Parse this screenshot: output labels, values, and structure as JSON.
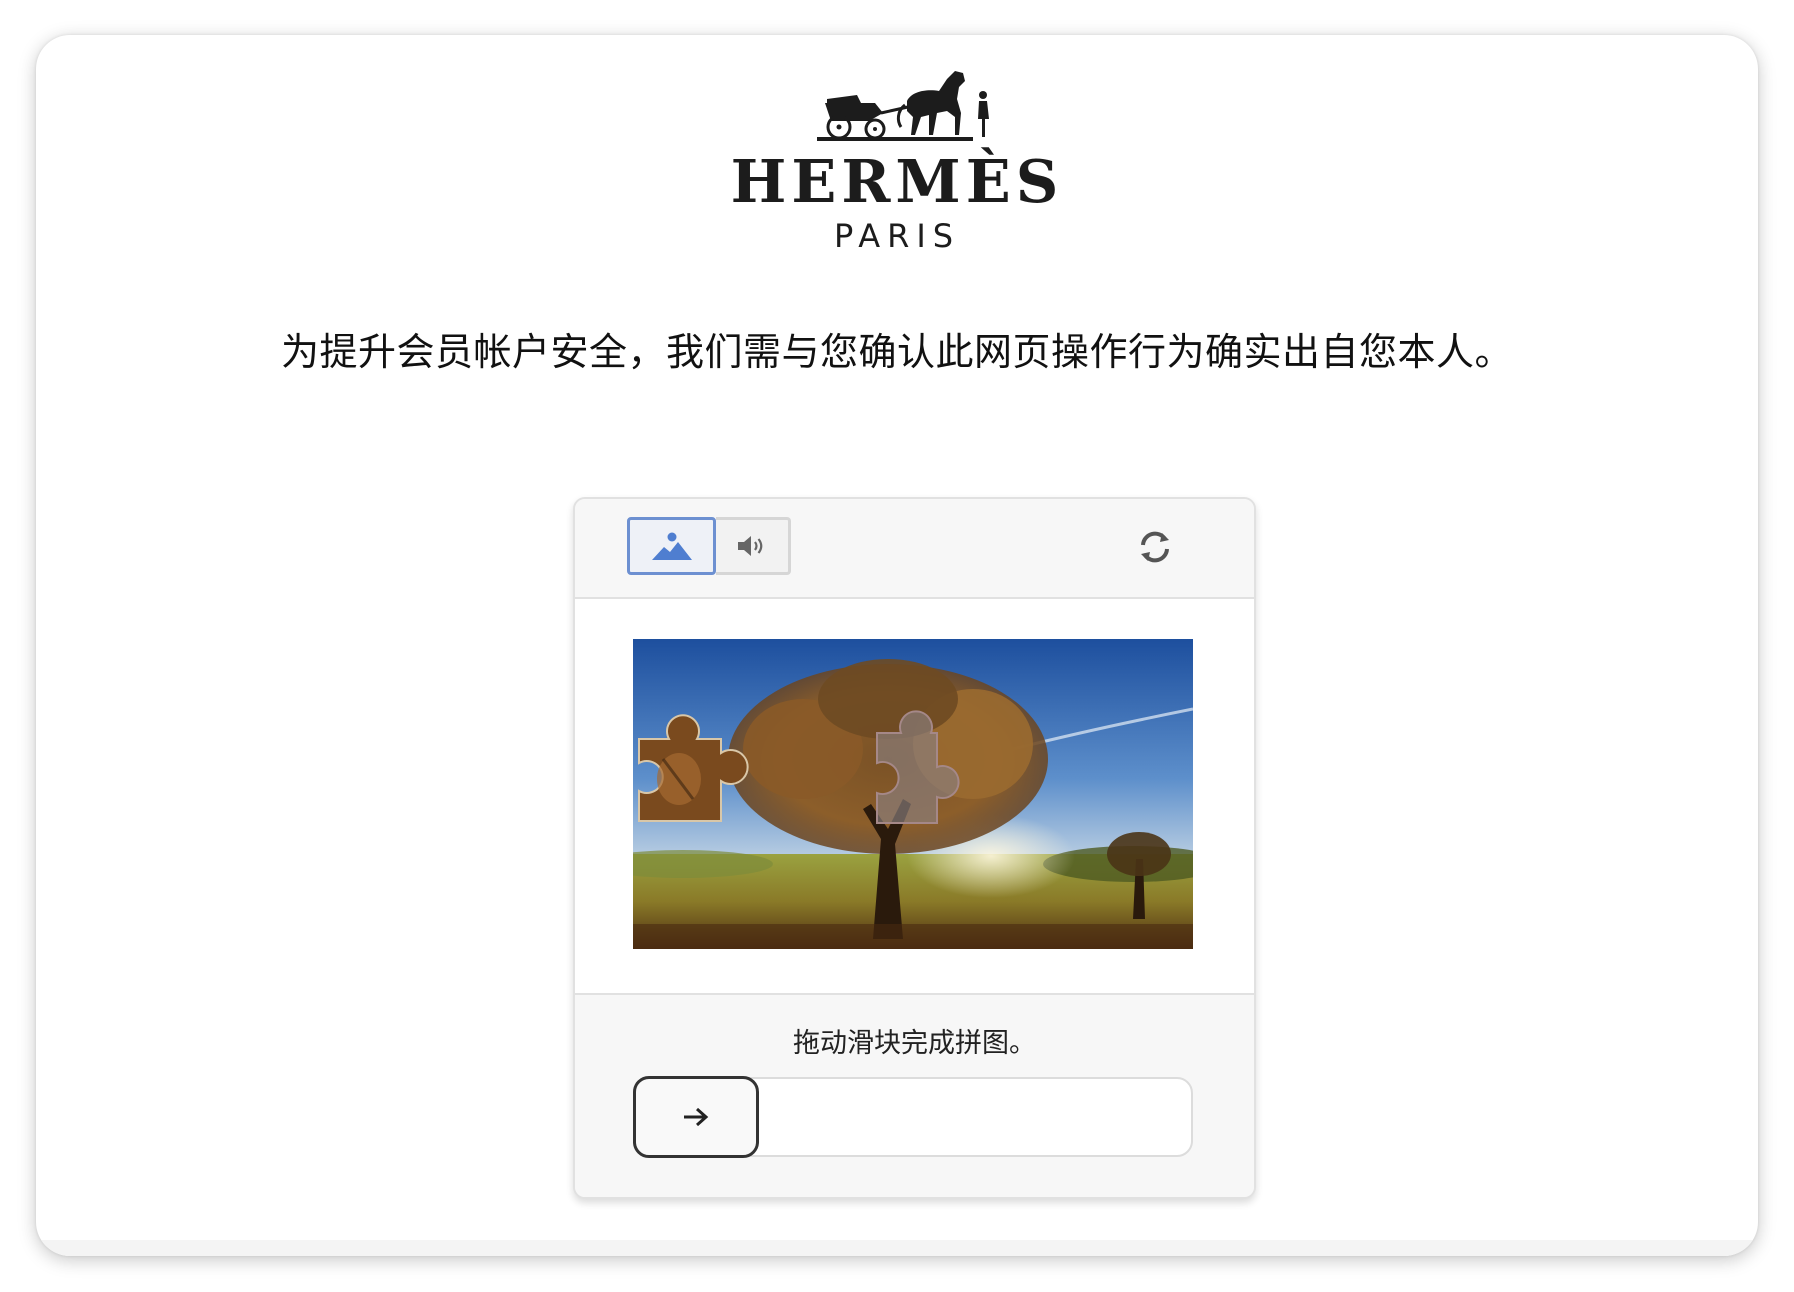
{
  "brand": {
    "logo_icon": "horse-carriage-logo",
    "name": "HERMÈS",
    "subtitle": "PARIS"
  },
  "notice": "为提升会员帐户安全，我们需与您确认此网页操作行为确实出自您本人。",
  "captcha": {
    "modes": [
      {
        "icon": "image-icon",
        "active": true
      },
      {
        "icon": "audio-icon",
        "active": false
      }
    ],
    "refresh_icon": "refresh-icon",
    "instruction": "拖动滑块完成拼图。",
    "slider_icon": "arrow-right-icon",
    "slider_progress": 0
  },
  "colors": {
    "active_mode_border": "#6d90d1",
    "slider_handle_border": "#333333",
    "text": "#111111"
  }
}
